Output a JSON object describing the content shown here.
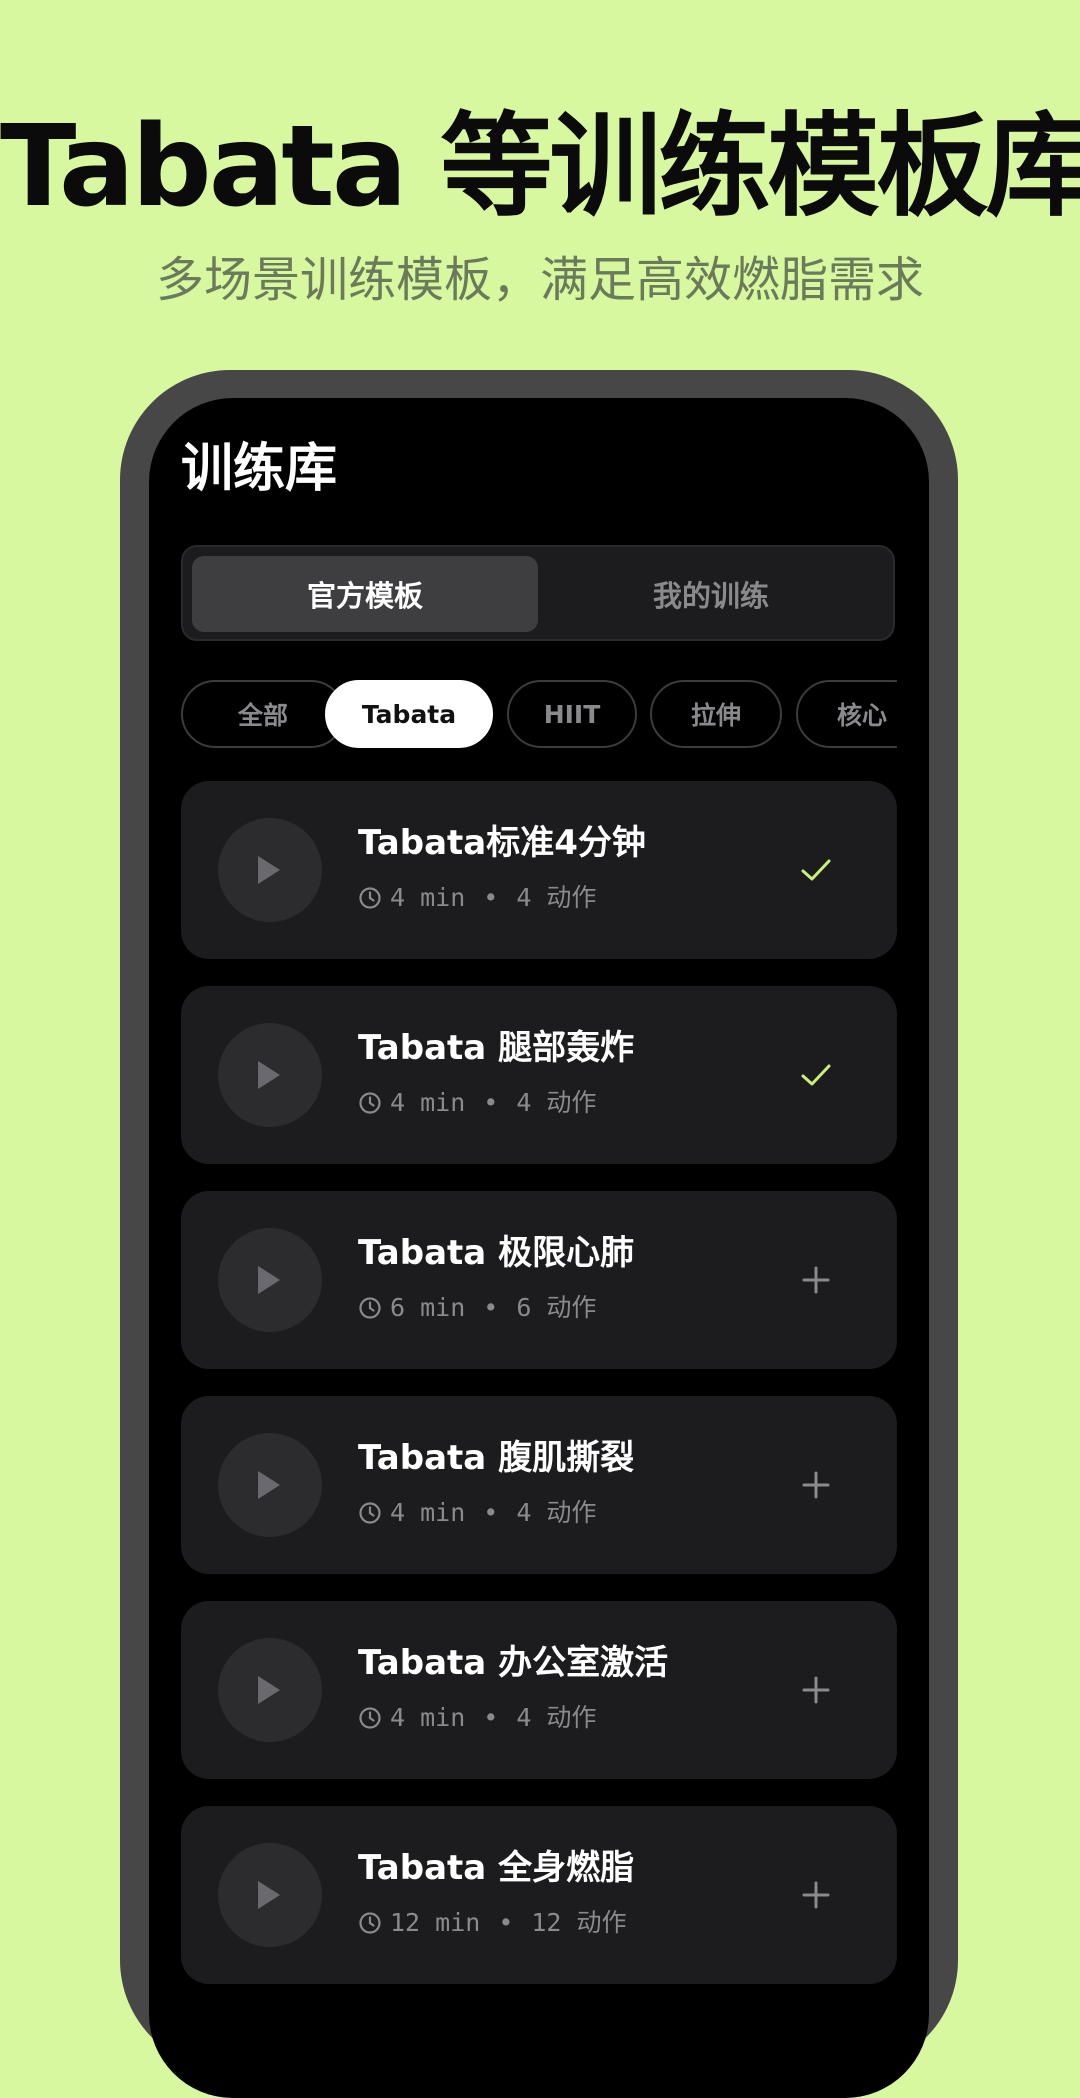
{
  "hero": {
    "title": "Tabata 等训练模板库",
    "subtitle": "多场景训练模板，满足高效燃脂需求"
  },
  "screen": {
    "title": "训练库",
    "segments": [
      {
        "label": "官方模板",
        "active": true
      },
      {
        "label": "我的训练",
        "active": false
      }
    ],
    "chips": [
      {
        "label": "全部",
        "selected": false
      },
      {
        "label": "Tabata",
        "selected": true
      },
      {
        "label": "HIIT",
        "selected": false
      },
      {
        "label": "拉伸",
        "selected": false
      },
      {
        "label": "核心",
        "selected": false
      }
    ],
    "workouts": [
      {
        "title": "Tabata标准4分钟",
        "duration": "4 min",
        "separator": "•",
        "count": "4 动作",
        "action": "check-icon"
      },
      {
        "title": "Tabata 腿部轰炸",
        "duration": "4 min",
        "separator": "•",
        "count": "4 动作",
        "action": "check-icon"
      },
      {
        "title": "Tabata 极限心肺",
        "duration": "6 min",
        "separator": "•",
        "count": "6 动作",
        "action": "plus-icon"
      },
      {
        "title": "Tabata 腹肌撕裂",
        "duration": "4 min",
        "separator": "•",
        "count": "4 动作",
        "action": "plus-icon"
      },
      {
        "title": "Tabata 办公室激活",
        "duration": "4 min",
        "separator": "•",
        "count": "4 动作",
        "action": "plus-icon"
      },
      {
        "title": "Tabata 全身燃脂",
        "duration": "12 min",
        "separator": "•",
        "count": "12 动作",
        "action": "plus-icon"
      }
    ]
  },
  "colors": {
    "background": "#d8f8a0",
    "accent": "#c9f07a",
    "card": "#1c1c1e",
    "muted": "#8a8a8e"
  }
}
